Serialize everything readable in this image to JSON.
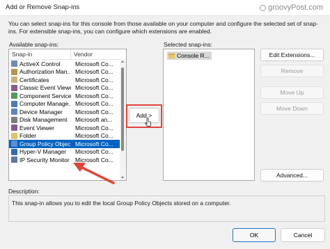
{
  "window": {
    "title": "Add or Remove Snap-ins",
    "watermark": "groovyPost.com"
  },
  "intro_text": "You can select snap-ins for this console from those available on your computer and configure the selected set of snap-ins. For extensible snap-ins, you can configure which extensions are enabled.",
  "available": {
    "label": "Available snap-ins:",
    "columns": {
      "snapin": "Snap-in",
      "vendor": "Vendor"
    },
    "rows": [
      {
        "name": "ActiveX Control",
        "vendor": "Microsoft Co...",
        "icon": "activex-icon",
        "color": "#6d8ab8"
      },
      {
        "name": "Authorization Man...",
        "vendor": "Microsoft Co...",
        "icon": "authorization-icon",
        "color": "#b8934b"
      },
      {
        "name": "Certificates",
        "vendor": "Microsoft Co...",
        "icon": "certificates-icon",
        "color": "#c9b27a"
      },
      {
        "name": "Classic Event Viewer",
        "vendor": "Microsoft Co...",
        "icon": "event-viewer-icon",
        "color": "#8a5a8f"
      },
      {
        "name": "Component Services",
        "vendor": "Microsoft Co...",
        "icon": "component-services-icon",
        "color": "#4f9a63"
      },
      {
        "name": "Computer Manage...",
        "vendor": "Microsoft Co...",
        "icon": "computer-management-icon",
        "color": "#4a7ab8"
      },
      {
        "name": "Device Manager",
        "vendor": "Microsoft Co...",
        "icon": "device-manager-icon",
        "color": "#5a87c4"
      },
      {
        "name": "Disk Management",
        "vendor": "Microsoft an...",
        "icon": "disk-management-icon",
        "color": "#7d7d7d"
      },
      {
        "name": "Event Viewer",
        "vendor": "Microsoft Co...",
        "icon": "event-viewer-icon",
        "color": "#8a5a8f"
      },
      {
        "name": "Folder",
        "vendor": "Microsoft Co...",
        "icon": "folder-icon",
        "color": "#e3c16a"
      },
      {
        "name": "Group Policy Objec...",
        "vendor": "Microsoft Co...",
        "icon": "group-policy-icon",
        "color": "#5a8fcf",
        "selected": true
      },
      {
        "name": "Hyper-V Manager",
        "vendor": "Microsoft Co...",
        "icon": "hyperv-icon",
        "color": "#2f6db4"
      },
      {
        "name": "IP Security Monitor",
        "vendor": "Microsoft Co...",
        "icon": "ip-security-icon",
        "color": "#5c7aa0"
      }
    ]
  },
  "add_button": "Add >",
  "selected": {
    "label": "Selected snap-ins:",
    "items": [
      {
        "name": "Console R...",
        "icon": "folder-icon"
      }
    ]
  },
  "buttons": {
    "edit_extensions": "Edit Extensions...",
    "remove": "Remove",
    "move_up": "Move Up",
    "move_down": "Move Down",
    "advanced": "Advanced...",
    "ok": "OK",
    "cancel": "Cancel"
  },
  "description": {
    "label": "Description:",
    "text": "This snap-in allows you to edit the local Group Policy Objects stored on a computer."
  },
  "colors": {
    "selection": "#0063c1",
    "highlight": "#e0443a"
  }
}
